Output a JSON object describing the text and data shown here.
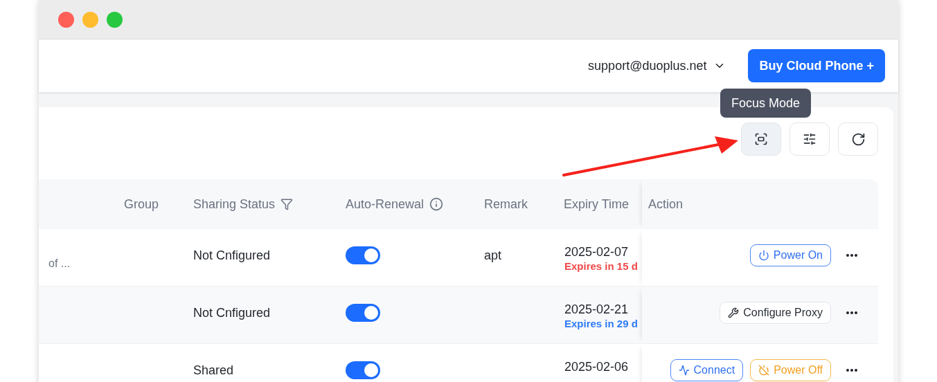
{
  "header": {
    "account": "support@duoplus.net",
    "primary_button": "Buy Cloud Phone +"
  },
  "tooltip": "Focus Mode",
  "toolbar": [
    {
      "kind": "focus",
      "selected": true
    },
    {
      "kind": "settings",
      "selected": false
    },
    {
      "kind": "refresh",
      "selected": false
    }
  ],
  "table": {
    "columns": [
      {
        "label": "Group",
        "kind": "plain"
      },
      {
        "label": "Sharing Status",
        "kind": "filter"
      },
      {
        "label": "Auto-Renewal",
        "kind": "info"
      },
      {
        "label": "Remark",
        "kind": "plain"
      },
      {
        "label": "Expiry Time",
        "kind": "plain"
      },
      {
        "label": "Action",
        "kind": "plain"
      }
    ],
    "rows": [
      {
        "column_1": "of ...",
        "sharing_status": "Not Cnfigured",
        "auto_renewal": true,
        "remark": "apt",
        "expiry_date": "2025-02-07",
        "expiry_note": "Expires in 15 d",
        "expiry_urgent": true,
        "actions": [
          {
            "kind": "power_on",
            "label": "Power On"
          }
        ]
      },
      {
        "sharing_status": "Not Cnfigured",
        "auto_renewal": true,
        "expiry_date": "2025-02-21",
        "expiry_note": "Expires in 29 d",
        "expiry_urgent": false,
        "actions": [
          {
            "kind": "proxy",
            "label": "Configure Proxy"
          }
        ]
      },
      {
        "sharing_status": "Shared",
        "auto_renewal": true,
        "expiry_date": "2025-02-06",
        "actions": [
          {
            "kind": "connect",
            "label": "Connect"
          },
          {
            "kind": "power_off",
            "label": "Power Off"
          }
        ]
      }
    ]
  }
}
